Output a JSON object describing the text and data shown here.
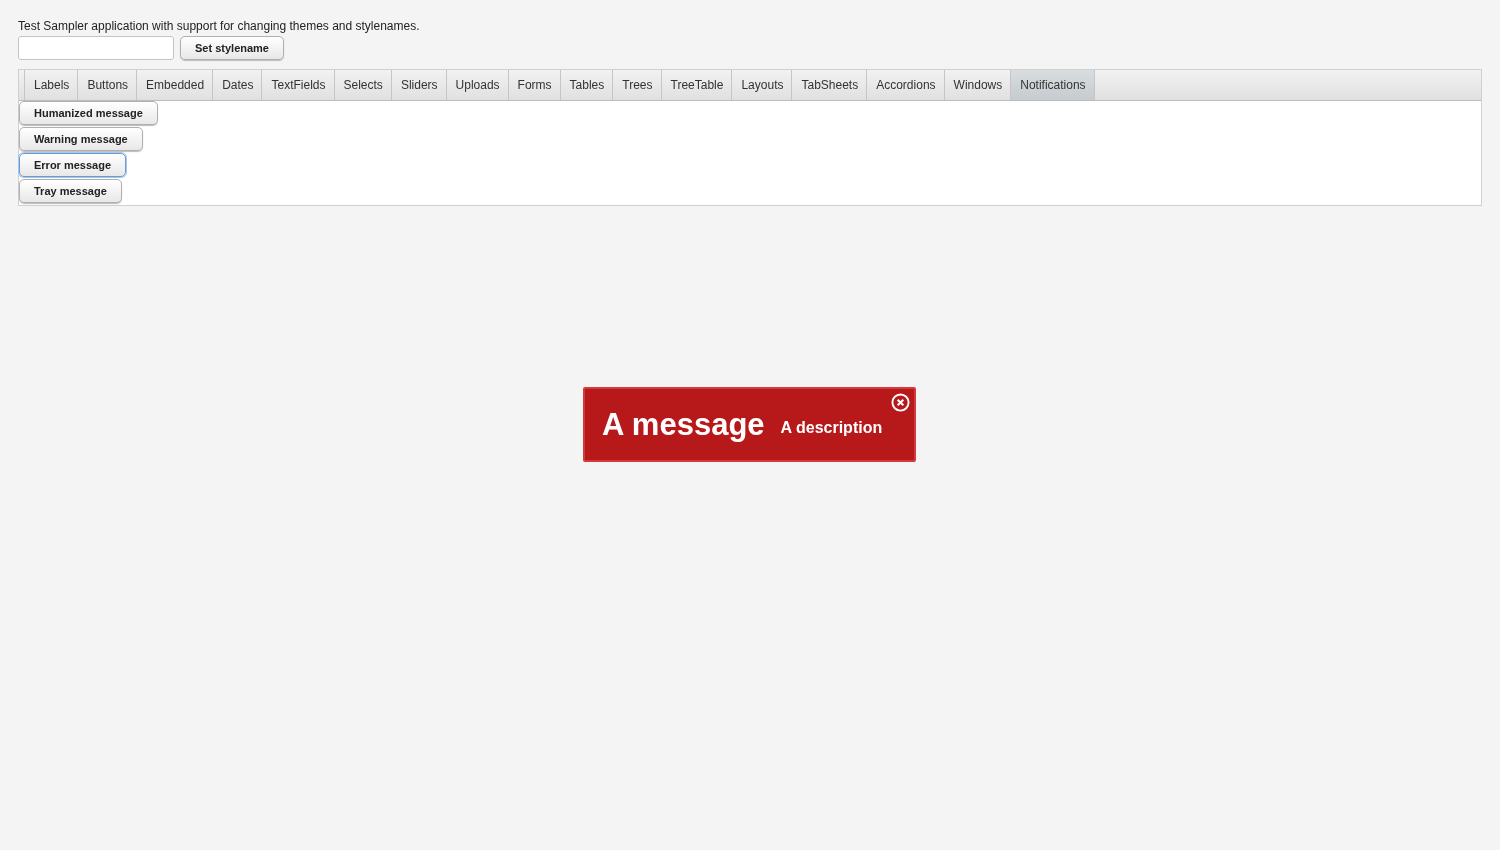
{
  "intro": "Test Sampler application with support for changing themes and stylenames.",
  "set_button": "Set stylename",
  "tabs": [
    {
      "label": "Labels",
      "selected": false
    },
    {
      "label": "Buttons",
      "selected": false
    },
    {
      "label": "Embedded",
      "selected": false
    },
    {
      "label": "Dates",
      "selected": false
    },
    {
      "label": "TextFields",
      "selected": false
    },
    {
      "label": "Selects",
      "selected": false
    },
    {
      "label": "Sliders",
      "selected": false
    },
    {
      "label": "Uploads",
      "selected": false
    },
    {
      "label": "Forms",
      "selected": false
    },
    {
      "label": "Tables",
      "selected": false
    },
    {
      "label": "Trees",
      "selected": false
    },
    {
      "label": "TreeTable",
      "selected": false
    },
    {
      "label": "Layouts",
      "selected": false
    },
    {
      "label": "TabSheets",
      "selected": false
    },
    {
      "label": "Accordions",
      "selected": false
    },
    {
      "label": "Windows",
      "selected": false
    },
    {
      "label": "Notifications",
      "selected": true
    }
  ],
  "buttons": [
    {
      "label": "Humanized message",
      "focused": false
    },
    {
      "label": "Warning message",
      "focused": false
    },
    {
      "label": "Error message",
      "focused": true
    },
    {
      "label": "Tray message",
      "focused": false
    }
  ],
  "notification": {
    "kind": "error",
    "caption": "A message",
    "description": "A description",
    "closable": true
  }
}
